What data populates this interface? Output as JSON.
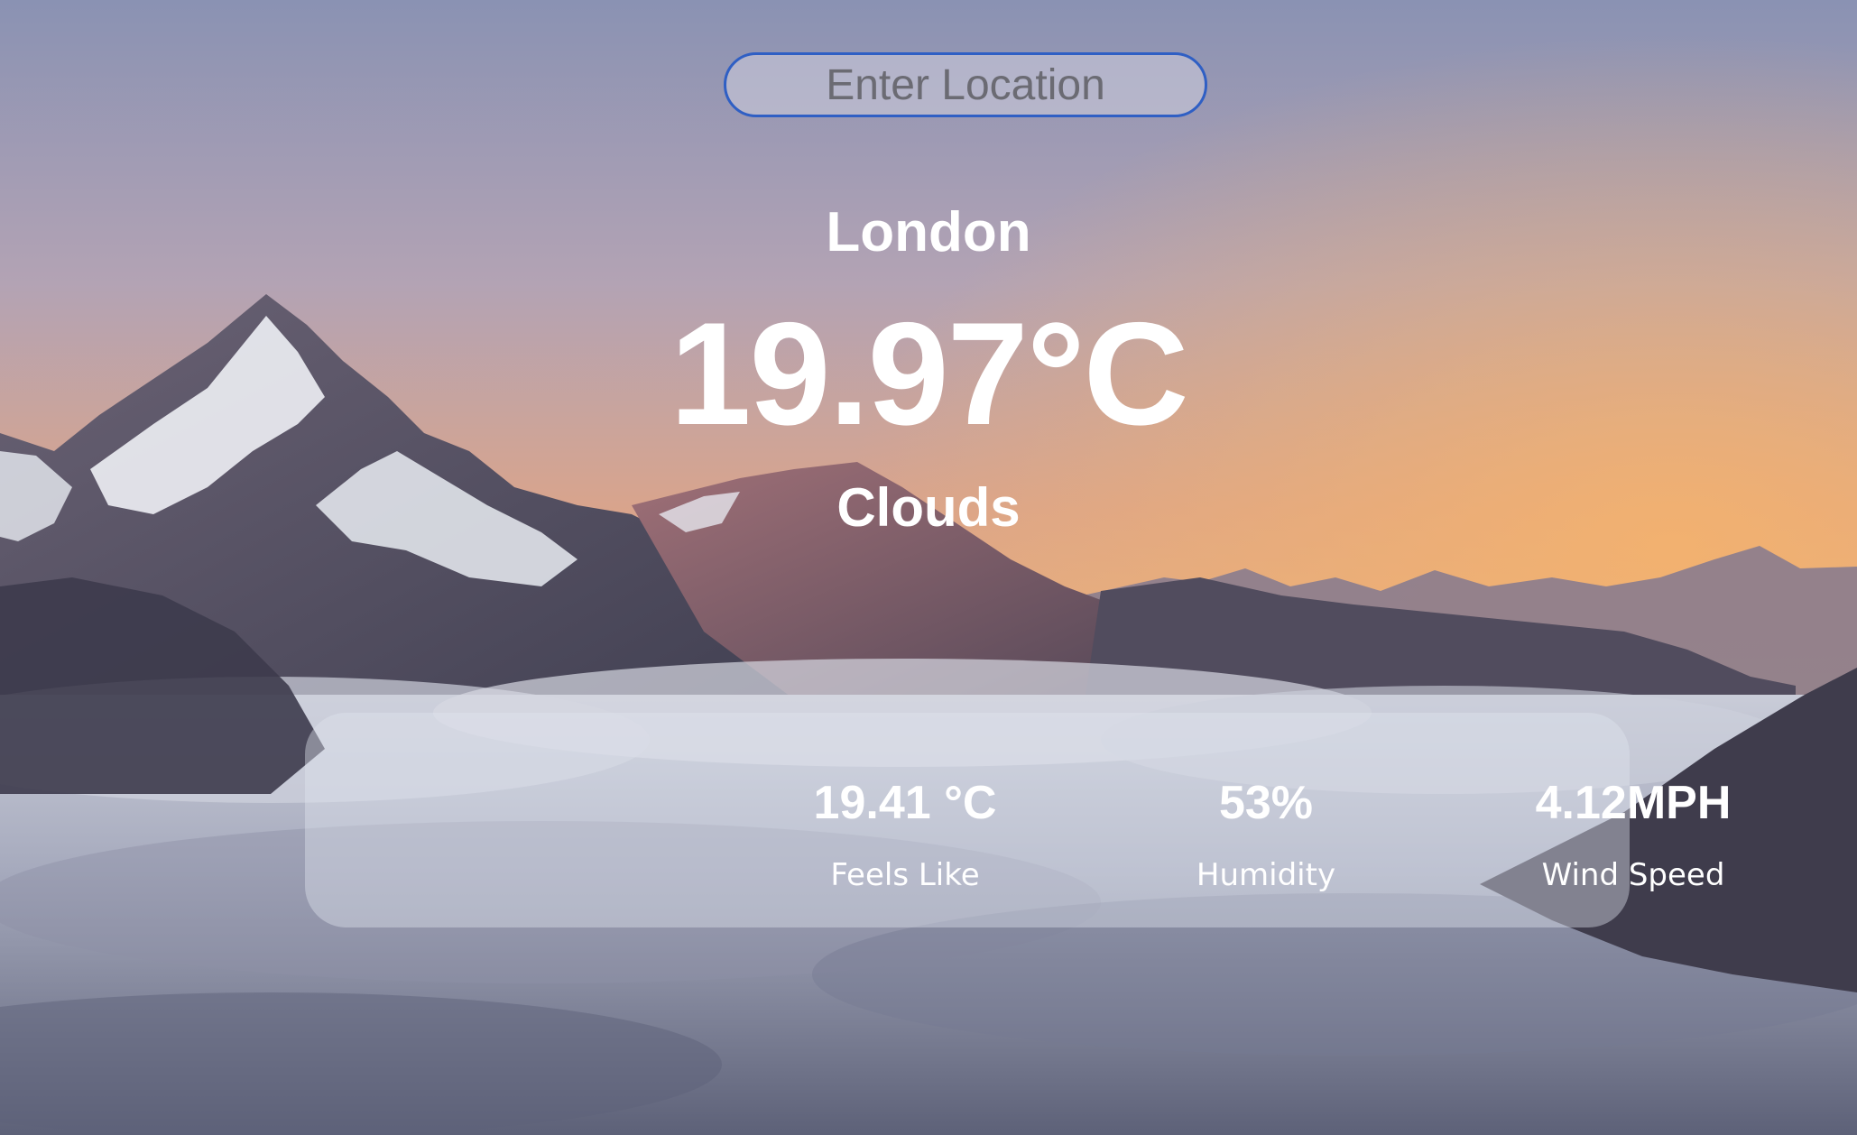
{
  "search": {
    "placeholder": "Enter Location"
  },
  "location": {
    "city": "London"
  },
  "current": {
    "temperature": "19.97°C",
    "condition": "Clouds"
  },
  "stats": [
    {
      "value": "19.41 °C",
      "label": "Feels Like"
    },
    {
      "value": "53%",
      "label": "Humidity"
    },
    {
      "value": "4.12MPH",
      "label": "Wind Speed"
    }
  ],
  "colors": {
    "search_border": "#2f5fc4",
    "text": "#ffffff"
  },
  "background_image": "mountain-sunset-above-clouds"
}
